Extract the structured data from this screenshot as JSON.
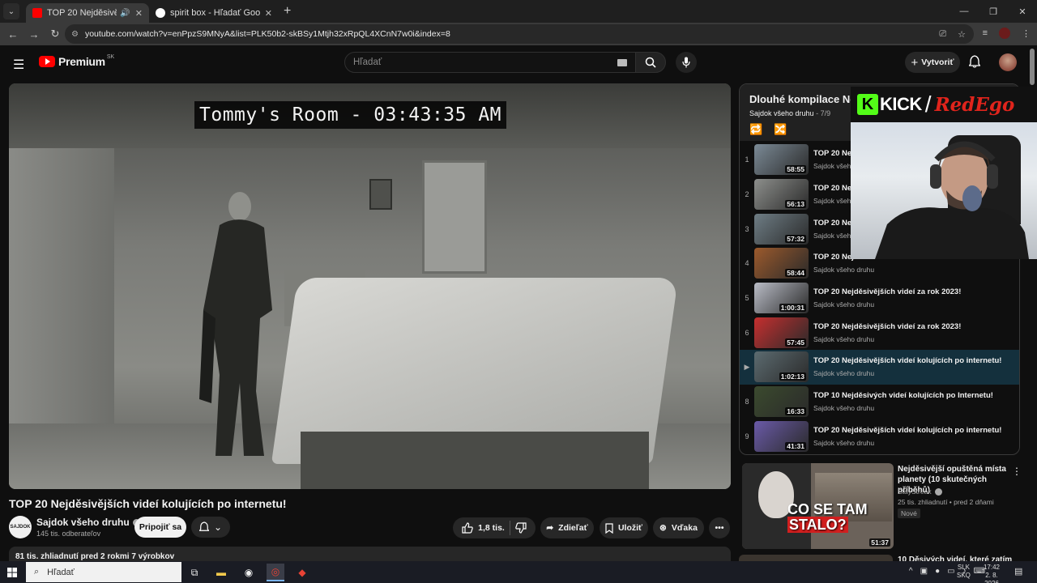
{
  "browser": {
    "tabs": [
      {
        "title": "TOP 20 Nejděsivějších vide",
        "active": true
      },
      {
        "title": "spirit box - Hľadať Googlom",
        "active": false
      }
    ],
    "url": "youtube.com/watch?v=enPpzS9MNyA&list=PLK50b2-skBSy1Mtjh32xRpQL4XCnN7w0i&index=8"
  },
  "header": {
    "logo_text": "Premium",
    "region": "SK",
    "search_placeholder": "Hľadať",
    "create_label": "Vytvoriť"
  },
  "video": {
    "osd_text": "Tommy's Room - 03:43:35 AM",
    "title": "TOP 20 Nejděsivějších videí kolujících po internetu!",
    "channel": "Sajdok všeho druhu",
    "channel_avatar_text": "SAJDOK",
    "subscribers": "145 tis. odberateľov",
    "join_label": "Pripojiť sa",
    "likes": "1,8 tis.",
    "share_label": "Zdieľať",
    "save_label": "Uložiť",
    "thanks_label": "Vďaka",
    "description_meta": "81 tis. zhliadnutí  pred 2 rokmi  7 výrobkov"
  },
  "playlist": {
    "title": "Dlouhé kompilace Ne",
    "channel": "Sajdok všeho druhu",
    "position": "7/9",
    "items": [
      {
        "index": "1",
        "title": "TOP 20 Nejd",
        "channel": "Sajdok všeho",
        "duration": "58:55",
        "thumb": "#7b8a96"
      },
      {
        "index": "2",
        "title": "TOP 20 Nejd",
        "channel": "Sajdok všeho",
        "duration": "56:13",
        "thumb": "#8d8f8c"
      },
      {
        "index": "3",
        "title": "TOP 20 Nejd",
        "channel": "Sajdok všeho",
        "duration": "57:32",
        "thumb": "#6e7d85"
      },
      {
        "index": "4",
        "title": "TOP 20 Nejd",
        "channel": "Sajdok všeho druhu",
        "duration": "58:44",
        "thumb": "#9c5a2c"
      },
      {
        "index": "5",
        "title": "TOP 20 Nejděsivějších videí za rok 2023!",
        "channel": "Sajdok všeho druhu",
        "duration": "1:00:31",
        "thumb": "#b9bcc6"
      },
      {
        "index": "6",
        "title": "TOP 20 Nejděsivějších videí za rok 2023!",
        "channel": "Sajdok všeho druhu",
        "duration": "57:45",
        "thumb": "#c62f2f"
      },
      {
        "index": "▶",
        "title": "TOP 20 Nejděsivějších videí kolujících po internetu!",
        "channel": "Sajdok všeho druhu",
        "duration": "1:02:13",
        "thumb": "#5c6b70",
        "current": true
      },
      {
        "index": "8",
        "title": "TOP 10 Nejděsivých videí kolujících po Internetu!",
        "channel": "Sajdok všeho druhu",
        "duration": "16:33",
        "thumb": "#3b4a2e"
      },
      {
        "index": "9",
        "title": "TOP 20 Nejděsivějších videí kolujících po internetu!",
        "channel": "Sajdok všeho druhu",
        "duration": "41:31",
        "thumb": "#6a5aa8"
      }
    ]
  },
  "overlay": {
    "kick_k": "K",
    "kick_word": "KICK",
    "slash": "/",
    "streamer": "RedEgo"
  },
  "recommendation": {
    "title": "Nejděsivější opuštěná místa planety (10 skutečných příběhů)",
    "channel": "StayStreak",
    "meta": "25 tis. zhliadnutí • pred 2 dňami",
    "badge": "Nové",
    "duration": "51:37",
    "thumb_line1": "CO SE TAM",
    "thumb_line2": "STALO?",
    "next_title": "10 Děsivých videí, které zatím"
  },
  "taskbar": {
    "search_placeholder": "Hľadať",
    "lang_line1": "SLK",
    "lang_line2": "SKQ",
    "time": "17:42",
    "date": "2. 8. 2026"
  }
}
